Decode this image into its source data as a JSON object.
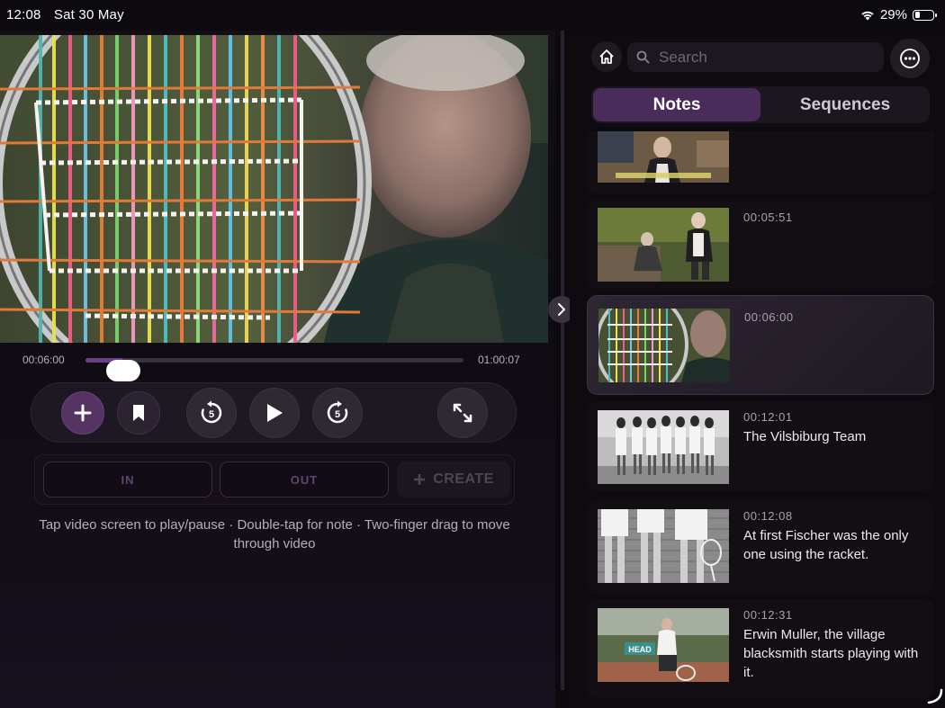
{
  "status": {
    "time": "12:08",
    "date": "Sat 30 May",
    "battery": "29%",
    "battery_level": 0.29
  },
  "player": {
    "current_time": "00:06:00",
    "duration": "01:00:07",
    "progress": 0.1,
    "mark_in": "IN",
    "mark_out": "OUT",
    "create": "CREATE",
    "hint": "Tap video screen to play/pause · Double-tap for note · Two-finger drag to move through video"
  },
  "sidebar": {
    "search_placeholder": "Search",
    "tabs": [
      {
        "label": "Notes",
        "active": true
      },
      {
        "label": "Sequences",
        "active": false
      }
    ],
    "notes": [
      {
        "time": "",
        "text": "",
        "thumb": "interview-woman"
      },
      {
        "time": "00:05:51",
        "text": "",
        "thumb": "garden-couple"
      },
      {
        "time": "00:06:00",
        "text": "",
        "thumb": "racket-man",
        "selected": true
      },
      {
        "time": "00:12:01",
        "text": "The Vilsbiburg Team",
        "thumb": "team-photo"
      },
      {
        "time": "00:12:08",
        "text": "At first Fischer was the only one using the racket.",
        "thumb": "legs-rackets"
      },
      {
        "time": "00:12:31",
        "text": "Erwin Muller, the village blacksmith starts playing with it.",
        "thumb": "tennis-court"
      }
    ]
  },
  "colors": {
    "accent": "#553464",
    "tab_active": "#4a2c5a"
  }
}
